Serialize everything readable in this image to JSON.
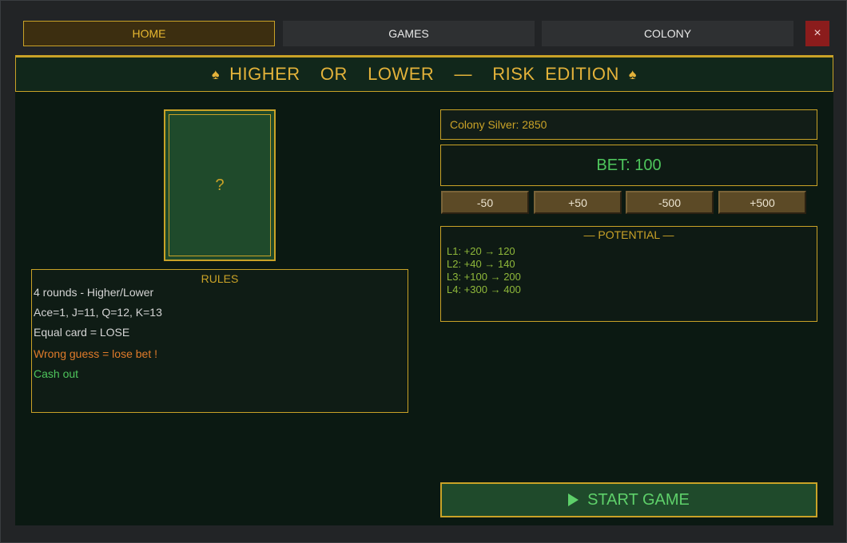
{
  "nav": {
    "home": "HOME",
    "games": "GAMES",
    "colony": "COLONY",
    "close_icon": "×"
  },
  "title": {
    "spade_left": "♠",
    "text": "HIGHER  OR  LOWER  —  RISK EDITION",
    "spade_right": "♠"
  },
  "card": {
    "face": "?"
  },
  "rules": {
    "title": "RULES",
    "lines": [
      "4 rounds - Higher/Lower",
      "Ace=1, J=11, Q=12, K=13",
      "Equal card = LOSE",
      "Wrong guess = lose bet !",
      "Cash out"
    ]
  },
  "silver": {
    "label": "Colony Silver: 2850"
  },
  "bet": {
    "label": "BET: 100",
    "buttons": [
      "-50",
      "+50",
      "-500",
      "+500"
    ]
  },
  "potential": {
    "title": "— POTENTIAL —",
    "lines": [
      "L1: +20 → 120",
      "L2: +40 → 140",
      "L3: +100 → 200",
      "L4: +300 → 400"
    ]
  },
  "start": {
    "label": "START GAME",
    "icon": "play-icon"
  },
  "colors": {
    "gold": "#c9a227",
    "green_text": "#4ec55c",
    "warn_text": "#e07b2a",
    "panel_bg": "#0b1912"
  }
}
